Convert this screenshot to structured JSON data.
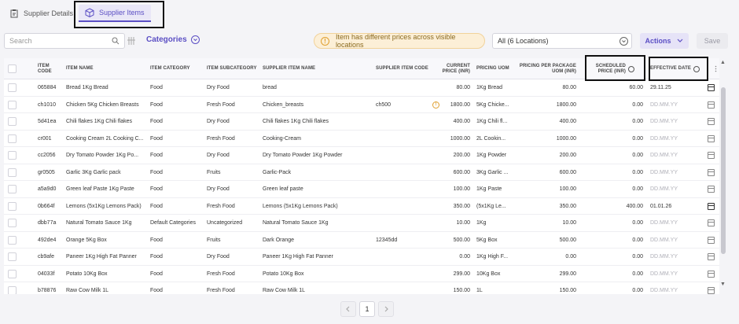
{
  "tabs": {
    "details_label": "Supplier Details",
    "items_label": "Supplier Items"
  },
  "toolbar": {
    "search_placeholder": "Search",
    "categories_label": "Categories",
    "warning_text": "Item has different prices across visible locations",
    "location_value": "All (6 Locations)",
    "actions_label": "Actions",
    "save_label": "Save"
  },
  "table": {
    "headers": {
      "code": "ITEM CODE",
      "name": "ITEM NAME",
      "category": "ITEM CATEGORY",
      "subcategory": "ITEM SUBCATEGORY",
      "supplier_name": "SUPPLIER ITEM NAME",
      "supplier_code": "SUPPLIER ITEM CODE",
      "current_price": "CURRENT PRICE (INR)",
      "uom": "PRICING UOM",
      "package_price": "PRICING PER PACKAGE UOM (INR)",
      "scheduled_price": "SCHEDULED PRICE (INR)",
      "effective_date": "EFFECTIVE DATE"
    },
    "rows": [
      {
        "code": "065884",
        "name": "Bread 1Kg Bread",
        "category": "Food",
        "subcategory": "Dry Food",
        "supplier_name": "bread",
        "supplier_code": "",
        "current_price": "80.00",
        "uom": "1Kg Bread",
        "package_price": "80.00",
        "scheduled_price": "60.00",
        "effective_date": "29.11.25",
        "date_set": true,
        "warn": false
      },
      {
        "code": "ch1010",
        "name": "Chicken 5Kg Chicken Breasts",
        "category": "Food",
        "subcategory": "Fresh Food",
        "supplier_name": "Chicken_breasts",
        "supplier_code": "ch500",
        "current_price": "1800.00",
        "uom": "5Kg Chicke...",
        "package_price": "1800.00",
        "scheduled_price": "0.00",
        "effective_date": "DD.MM.YY",
        "date_set": false,
        "warn": true
      },
      {
        "code": "5d41ea",
        "name": "Chili flakes 1Kg Chili flakes",
        "category": "Food",
        "subcategory": "Dry Food",
        "supplier_name": "Chili flakes 1Kg Chili flakes",
        "supplier_code": "",
        "current_price": "400.00",
        "uom": "1Kg Chili fl...",
        "package_price": "400.00",
        "scheduled_price": "0.00",
        "effective_date": "DD.MM.YY",
        "date_set": false,
        "warn": false
      },
      {
        "code": "cr001",
        "name": "Cooking Cream 2L Cooking C...",
        "category": "Food",
        "subcategory": "Fresh Food",
        "supplier_name": "Cooking-Cream",
        "supplier_code": "",
        "current_price": "1000.00",
        "uom": "2L Cookin...",
        "package_price": "1000.00",
        "scheduled_price": "0.00",
        "effective_date": "DD.MM.YY",
        "date_set": false,
        "warn": false
      },
      {
        "code": "cc2056",
        "name": "Dry Tomato Powder 1Kg Po...",
        "category": "Food",
        "subcategory": "Dry Food",
        "supplier_name": "Dry Tomato Powder 1Kg Powder",
        "supplier_code": "",
        "current_price": "200.00",
        "uom": "1Kg Powder",
        "package_price": "200.00",
        "scheduled_price": "0.00",
        "effective_date": "DD.MM.YY",
        "date_set": false,
        "warn": false
      },
      {
        "code": "gr0505",
        "name": "Garlic 3Kg Garlic pack",
        "category": "Food",
        "subcategory": "Fruits",
        "supplier_name": "Garlic-Pack",
        "supplier_code": "",
        "current_price": "600.00",
        "uom": "3Kg Garlic ...",
        "package_price": "600.00",
        "scheduled_price": "0.00",
        "effective_date": "DD.MM.YY",
        "date_set": false,
        "warn": false
      },
      {
        "code": "a5a9d0",
        "name": "Green leaf Paste 1Kg Paste",
        "category": "Food",
        "subcategory": "Dry Food",
        "supplier_name": "Green leaf paste",
        "supplier_code": "",
        "current_price": "100.00",
        "uom": "1Kg Paste",
        "package_price": "100.00",
        "scheduled_price": "0.00",
        "effective_date": "DD.MM.YY",
        "date_set": false,
        "warn": false
      },
      {
        "code": "0b664f",
        "name": "Lemons (5x1Kg Lemons Pack)",
        "category": "Food",
        "subcategory": "Fresh Food",
        "supplier_name": "Lemons (5x1Kg Lemons Pack)",
        "supplier_code": "",
        "current_price": "350.00",
        "uom": "(5x1Kg Le...",
        "package_price": "350.00",
        "scheduled_price": "400.00",
        "effective_date": "01.01.26",
        "date_set": true,
        "warn": false
      },
      {
        "code": "dbb77a",
        "name": "Natural Tomato Sauce 1Kg",
        "category": "Default Categories",
        "subcategory": "Uncategorized",
        "supplier_name": "Natural Tomato Sauce 1Kg",
        "supplier_code": "",
        "current_price": "10.00",
        "uom": "1Kg",
        "package_price": "10.00",
        "scheduled_price": "0.00",
        "effective_date": "DD.MM.YY",
        "date_set": false,
        "warn": false
      },
      {
        "code": "492de4",
        "name": "Orange 5Kg Box",
        "category": "Food",
        "subcategory": "Fruits",
        "supplier_name": "Dark Orange",
        "supplier_code": "12345dd",
        "current_price": "500.00",
        "uom": "5Kg Box",
        "package_price": "500.00",
        "scheduled_price": "0.00",
        "effective_date": "DD.MM.YY",
        "date_set": false,
        "warn": false
      },
      {
        "code": "cb9afe",
        "name": "Paneer 1Kg High Fat Panner",
        "category": "Food",
        "subcategory": "Dry Food",
        "supplier_name": "Paneer 1Kg High Fat Panner",
        "supplier_code": "",
        "current_price": "0.00",
        "uom": "1Kg High F...",
        "package_price": "0.00",
        "scheduled_price": "0.00",
        "effective_date": "DD.MM.YY",
        "date_set": false,
        "warn": false
      },
      {
        "code": "04033f",
        "name": "Potato 10Kg Box",
        "category": "Food",
        "subcategory": "Fresh Food",
        "supplier_name": "Potato 10Kg Box",
        "supplier_code": "",
        "current_price": "299.00",
        "uom": "10Kg Box",
        "package_price": "299.00",
        "scheduled_price": "0.00",
        "effective_date": "DD.MM.YY",
        "date_set": false,
        "warn": false
      },
      {
        "code": "b78876",
        "name": "Raw Cow Milk 1L",
        "category": "Food",
        "subcategory": "Fresh Food",
        "supplier_name": "Raw Cow Milk 1L",
        "supplier_code": "",
        "current_price": "150.00",
        "uom": "1L",
        "package_price": "150.00",
        "scheduled_price": "0.00",
        "effective_date": "DD.MM.YY",
        "date_set": false,
        "warn": false
      }
    ]
  },
  "pagination": {
    "current_page": "1",
    "prev_icon": "chevron-left-icon",
    "next_icon": "chevron-right-icon"
  },
  "colors": {
    "accent": "#5b4fc4",
    "warning": "#e0a030",
    "annotation_box": "#111111"
  }
}
